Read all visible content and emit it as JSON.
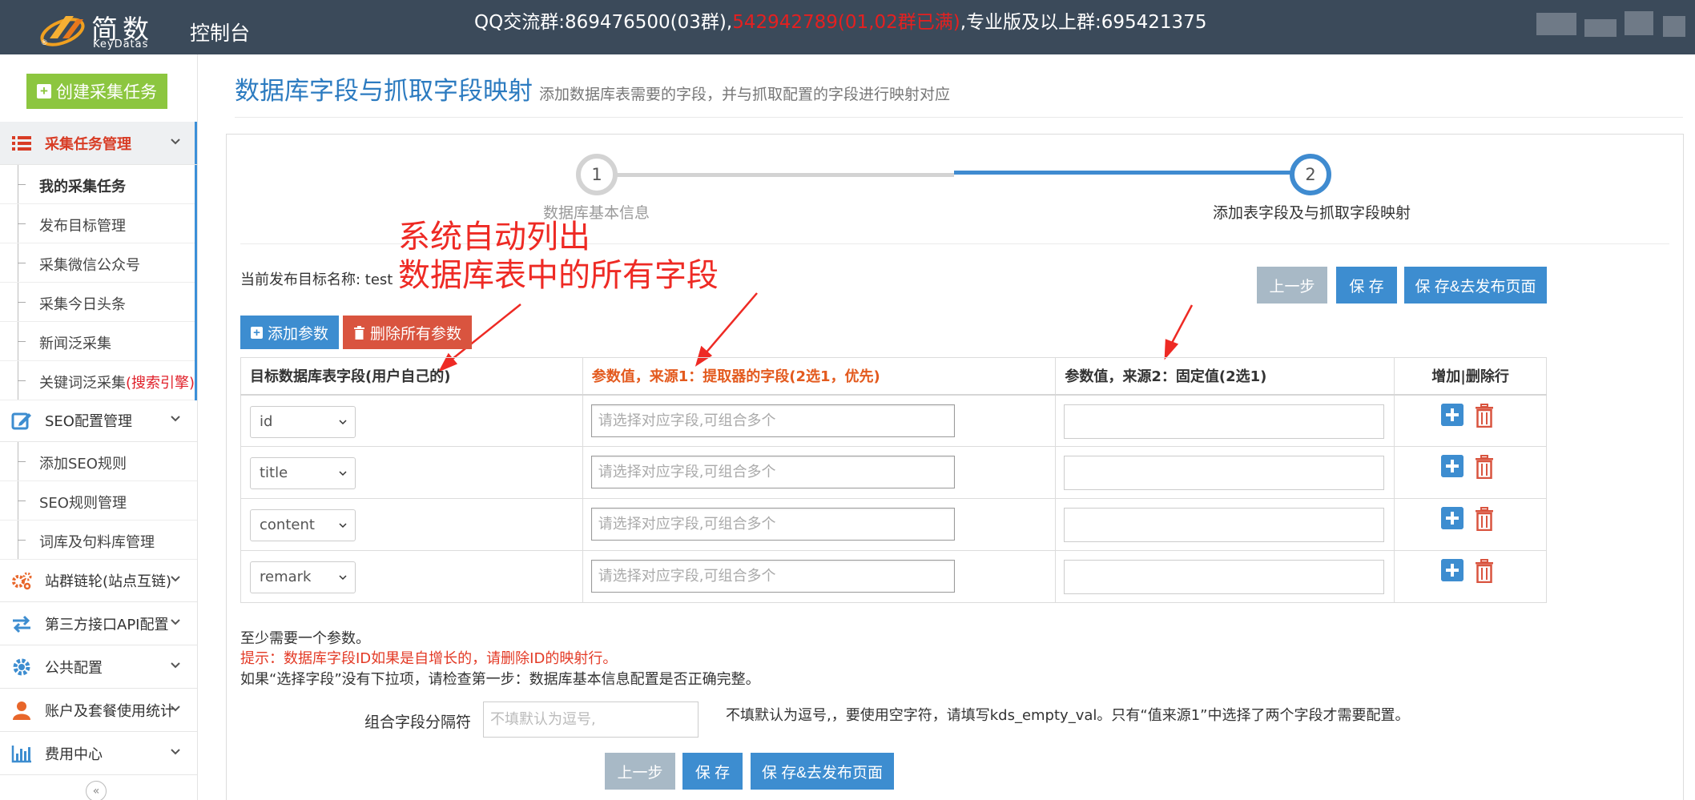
{
  "header": {
    "logo_cn": "简数",
    "logo_en": "KeyDatas",
    "console": "控制台",
    "qq_prefix": "QQ交流群:869476500(03群),",
    "qq_red": "542942789(01,02群已满)",
    "qq_suffix": ",专业版及以上群:695421375"
  },
  "sidebar": {
    "create_label": "创建采集任务",
    "task_group": {
      "label": "采集任务管理",
      "items": [
        "我的采集任务",
        "发布目标管理",
        "采集微信公众号",
        "采集今日头条",
        "新闻泛采集"
      ],
      "last_item": {
        "label": "关键词泛采集",
        "red": "(搜索引擎)"
      }
    },
    "seo_group": {
      "label": "SEO配置管理",
      "items": [
        "添加SEO规则",
        "SEO规则管理",
        "词库及句料库管理"
      ]
    },
    "groups": [
      "站群链轮(站点互链)",
      "第三方接口API配置",
      "公共配置",
      "账户及套餐使用统计",
      "费用中心"
    ],
    "collapse": "«"
  },
  "page": {
    "title": "数据库字段与抓取字段映射",
    "subtitle": "添加数据库表需要的字段，并与抓取配置的字段进行映射对应"
  },
  "steps": [
    {
      "num": "1",
      "label": "数据库基本信息"
    },
    {
      "num": "2",
      "label": "添加表字段及与抓取字段映射"
    }
  ],
  "target": {
    "label": "当前发布目标名称: test"
  },
  "annotation": {
    "line1": "系统自动列出",
    "line2": "数据库表中的所有字段"
  },
  "buttons": {
    "prev": "上一步",
    "save": "保 存",
    "save_publish": "保 存&去发布页面",
    "add_param": "添加参数",
    "delete_all": "删除所有参数"
  },
  "table": {
    "headers": [
      "目标数据库表字段(用户自己的)",
      "参数值，来源1：提取器的字段(2选1，优先)",
      "参数值，来源2：固定值(2选1)",
      "增加|删除行"
    ],
    "rows": [
      {
        "field": "id"
      },
      {
        "field": "title"
      },
      {
        "field": "content"
      },
      {
        "field": "remark"
      }
    ],
    "input_placeholder": "请选择对应字段,可组合多个"
  },
  "notes": {
    "line1": "至少需要一个参数。",
    "line2": "提示：数据库字段ID如果是自增长的，请删除ID的映射行。",
    "line3": "如果“选择字段”没有下拉项，请检查第一步：数据库基本信息配置是否正确完整。"
  },
  "separator": {
    "label": "组合字段分隔符",
    "placeholder": "不填默认为逗号,",
    "help": "不填默认为逗号,，要使用空字符，请填写kds_empty_val。只有“值来源1”中选择了两个字段才需要配置。"
  },
  "colors": {
    "topbar": "#3b4a5a",
    "accent": "#3d8dd0",
    "green": "#8cc63f",
    "danger": "#d9543f",
    "annotation": "#ee2a24"
  }
}
